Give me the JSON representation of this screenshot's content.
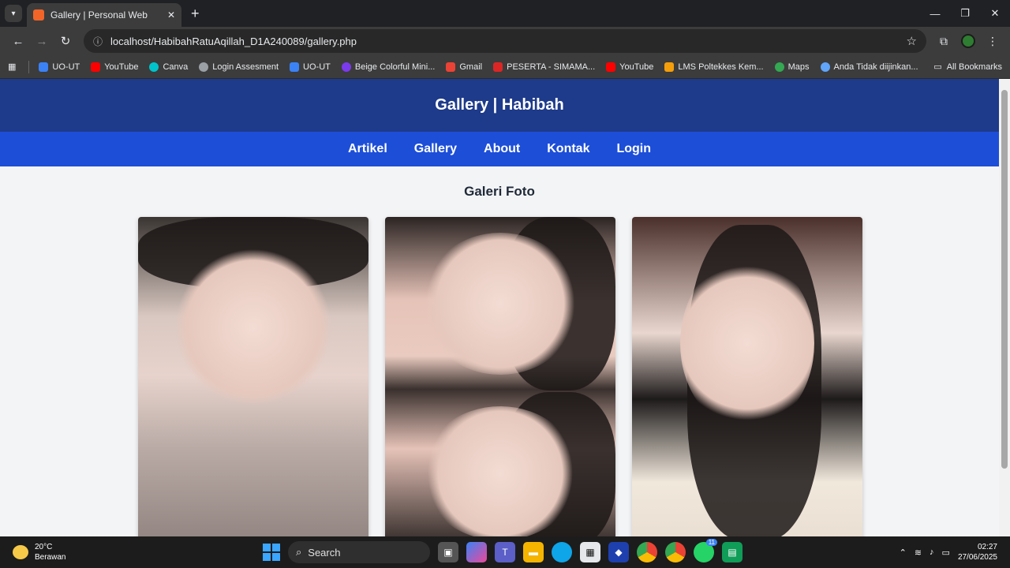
{
  "browser": {
    "tab_title": "Gallery | Personal Web",
    "tab_close": "✕",
    "new_tab": "+",
    "url": "localhost/HabibahRatuAqillah_D1A240089/gallery.php",
    "bookmarks": [
      {
        "label": "UO-UT",
        "color": "#3b82f6"
      },
      {
        "label": "YouTube",
        "color": "#ff0000"
      },
      {
        "label": "Canva",
        "color": "#00c4cc"
      },
      {
        "label": "Login Assesment",
        "color": "#9aa0a6"
      },
      {
        "label": "UO-UT",
        "color": "#3b82f6"
      },
      {
        "label": "Beige Colorful Mini...",
        "color": "#7c3aed"
      },
      {
        "label": "Gmail",
        "color": "#ea4335"
      },
      {
        "label": "PESERTA - SIMAMA...",
        "color": "#dc2626"
      },
      {
        "label": "YouTube",
        "color": "#ff0000"
      },
      {
        "label": "LMS Poltekkes Kem...",
        "color": "#f59e0b"
      },
      {
        "label": "Maps",
        "color": "#34a853"
      },
      {
        "label": "Anda Tidak diijinkan...",
        "color": "#60a5fa"
      }
    ],
    "all_bookmarks": "All Bookmarks"
  },
  "site": {
    "header_title": "Gallery | Habibah",
    "nav": [
      "Artikel",
      "Gallery",
      "About",
      "Kontak",
      "Login"
    ],
    "gallery_title": "Galeri Foto",
    "photos": [
      "portrait-photo-1",
      "portrait-photo-2",
      "portrait-photo-3"
    ]
  },
  "taskbar": {
    "temp": "20°C",
    "weather": "Berawan",
    "search_label": "Search",
    "whatsapp_badge": "11",
    "time": "02:27",
    "date": "27/06/2025"
  }
}
